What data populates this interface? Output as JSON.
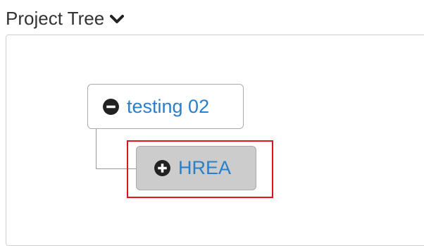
{
  "header": {
    "title": "Project Tree",
    "toggle_icon": "chevron-down-icon"
  },
  "tree": {
    "root": {
      "label": "testing 02",
      "icon": "minus-circle-icon",
      "state": "expanded"
    },
    "children": [
      {
        "label": "HREA",
        "icon": "plus-circle-icon",
        "state": "collapsed",
        "selected": true
      }
    ]
  },
  "colors": {
    "link": "#2a7fc9",
    "highlight": "#e0141d",
    "selected_bg": "#cccccc"
  }
}
